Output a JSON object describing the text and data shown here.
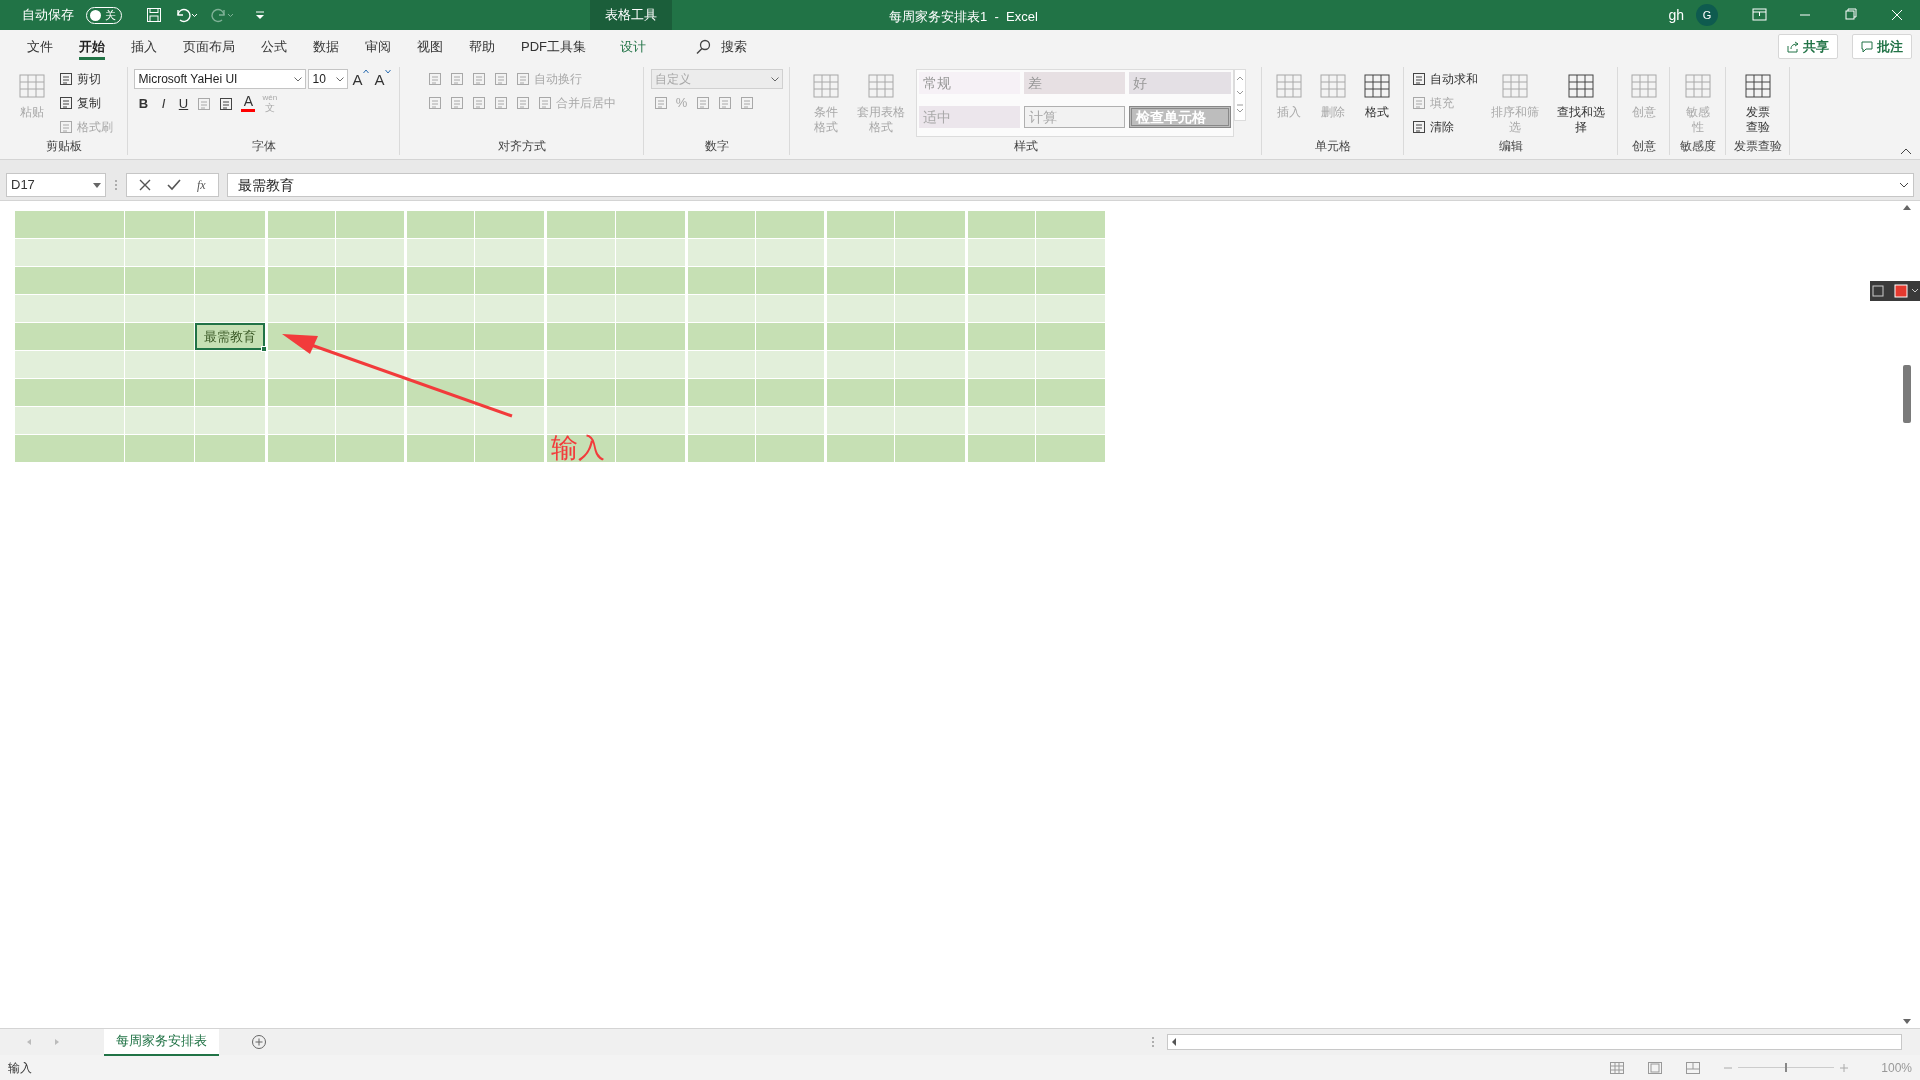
{
  "title_bar": {
    "autosave_label": "自动保存",
    "autosave_on": false,
    "autosave_state": "关",
    "context_tab": "表格工具",
    "title": "每周家务安排表1  -  Excel",
    "user": "gh",
    "avatar": "G"
  },
  "menu_tabs": [
    {
      "label": "文件",
      "selected": false,
      "kind": "normal"
    },
    {
      "label": "开始",
      "selected": true,
      "kind": "normal"
    },
    {
      "label": "插入",
      "selected": false,
      "kind": "normal"
    },
    {
      "label": "页面布局",
      "selected": false,
      "kind": "normal"
    },
    {
      "label": "公式",
      "selected": false,
      "kind": "normal"
    },
    {
      "label": "数据",
      "selected": false,
      "kind": "normal"
    },
    {
      "label": "审阅",
      "selected": false,
      "kind": "normal"
    },
    {
      "label": "视图",
      "selected": false,
      "kind": "normal"
    },
    {
      "label": "帮助",
      "selected": false,
      "kind": "normal"
    },
    {
      "label": "PDF工具集",
      "selected": false,
      "kind": "normal"
    },
    {
      "label": "设计",
      "selected": false,
      "kind": "contextual"
    }
  ],
  "search": {
    "label": "搜索"
  },
  "share_button": "共享",
  "comment_button": "批注",
  "ribbon": {
    "groups": [
      {
        "label": "剪贴板",
        "items": [
          {
            "kind": "large",
            "label": "粘贴",
            "disabled": true
          },
          {
            "kind": "stack",
            "rows": [
              {
                "items": [
                  {
                    "kind": "small",
                    "label": "剪切",
                    "disabled": false
                  }
                ]
              },
              {
                "items": [
                  {
                    "kind": "small",
                    "label": "复制",
                    "disabled": false
                  }
                ]
              },
              {
                "items": [
                  {
                    "kind": "small",
                    "label": "格式刷",
                    "disabled": true
                  }
                ]
              }
            ]
          }
        ]
      },
      {
        "label": "字体",
        "items": [
          {
            "kind": "stack",
            "rows": [
              {
                "items": [
                  {
                    "kind": "combo",
                    "label": "Microsoft YaHei UI",
                    "disabled": false
                  },
                  {
                    "kind": "combo",
                    "label": "10",
                    "disabled": false
                  },
                  {
                    "kind": "grow",
                    "label": "A",
                    "disabled": false
                  },
                  {
                    "kind": "shrink",
                    "label": "A",
                    "disabled": false
                  }
                ]
              },
              {
                "items": [
                  {
                    "kind": "glyph",
                    "label": "B",
                    "disabled": false
                  },
                  {
                    "kind": "glyph",
                    "label": "I",
                    "disabled": false
                  },
                  {
                    "kind": "glyph",
                    "label": "U",
                    "disabled": false
                  },
                  {
                    "kind": "icon",
                    "disabled": true
                  },
                  {
                    "kind": "icon",
                    "disabled": false
                  },
                  {
                    "kind": "color",
                    "label": "A",
                    "disabled": false
                  },
                  {
                    "kind": "phonetic",
                    "label": "wén",
                    "sub": "文",
                    "disabled": true
                  }
                ]
              }
            ]
          }
        ]
      },
      {
        "label": "对齐方式",
        "items": [
          {
            "kind": "stack",
            "rows": [
              {
                "items": [
                  {
                    "kind": "icon",
                    "disabled": true
                  },
                  {
                    "kind": "icon",
                    "disabled": true
                  },
                  {
                    "kind": "icon",
                    "disabled": true
                  },
                  {
                    "kind": "icon",
                    "disabled": true
                  },
                  {
                    "kind": "small",
                    "label": "自动换行",
                    "disabled": true
                  }
                ]
              },
              {
                "items": [
                  {
                    "kind": "icon",
                    "disabled": true
                  },
                  {
                    "kind": "icon",
                    "disabled": true
                  },
                  {
                    "kind": "icon",
                    "disabled": true
                  },
                  {
                    "kind": "icon",
                    "disabled": true
                  },
                  {
                    "kind": "icon",
                    "disabled": true
                  },
                  {
                    "kind": "small",
                    "label": "合并后居中",
                    "disabled": true
                  }
                ]
              }
            ]
          }
        ]
      },
      {
        "label": "数字",
        "items": [
          {
            "kind": "stack",
            "rows": [
              {
                "items": [
                  {
                    "kind": "combo",
                    "label": "自定义",
                    "disabled": true
                  }
                ]
              },
              {
                "items": [
                  {
                    "kind": "icon",
                    "disabled": true
                  },
                  {
                    "kind": "glyph",
                    "label": "%",
                    "disabled": true
                  },
                  {
                    "kind": "icon",
                    "disabled": true
                  },
                  {
                    "kind": "icon",
                    "disabled": true
                  },
                  {
                    "kind": "icon",
                    "disabled": true
                  }
                ]
              }
            ]
          }
        ]
      },
      {
        "label": "样式",
        "items": [
          {
            "kind": "large",
            "label": "条件格式",
            "disabled": true
          },
          {
            "kind": "large",
            "label": "套用表格格式",
            "disabled": true
          },
          {
            "kind": "styles",
            "cells": [
              {
                "label": "常规",
                "kind": "normal"
              },
              {
                "label": "差",
                "kind": "bad"
              },
              {
                "label": "好",
                "kind": "good"
              },
              {
                "label": "适中",
                "kind": "neutral"
              },
              {
                "label": "计算",
                "kind": "calculation"
              },
              {
                "label": "检查单元格",
                "kind": "check"
              }
            ]
          }
        ]
      },
      {
        "label": "单元格",
        "items": [
          {
            "kind": "large",
            "label": "插入",
            "disabled": true
          },
          {
            "kind": "large",
            "label": "删除",
            "disabled": true
          },
          {
            "kind": "large",
            "label": "格式",
            "disabled": false
          }
        ]
      },
      {
        "label": "编辑",
        "items": [
          {
            "kind": "stack",
            "rows": [
              {
                "items": [
                  {
                    "kind": "small",
                    "label": "自动求和",
                    "disabled": false
                  }
                ]
              },
              {
                "items": [
                  {
                    "kind": "small",
                    "label": "填充",
                    "disabled": true
                  }
                ]
              },
              {
                "items": [
                  {
                    "kind": "small",
                    "label": "清除",
                    "disabled": false
                  }
                ]
              }
            ]
          },
          {
            "kind": "large",
            "label": "排序和筛选",
            "disabled": true
          },
          {
            "kind": "large",
            "label": "查找和选择",
            "disabled": false
          }
        ]
      },
      {
        "label": "创意",
        "items": [
          {
            "kind": "large",
            "label": "创意",
            "disabled": true
          }
        ]
      },
      {
        "label": "敏感度",
        "items": [
          {
            "kind": "large",
            "label": "敏感性",
            "disabled": true
          }
        ]
      },
      {
        "label": "发票查验",
        "items": [
          {
            "kind": "large",
            "label": "发票查验",
            "disabled": false
          }
        ]
      }
    ]
  },
  "formula_bar": {
    "name_box": "D17",
    "function_button": "fx",
    "formula": "最需教育"
  },
  "sheet": {
    "active_cell": "最需教育"
  },
  "annotation": {
    "text": "输入"
  },
  "sheet_tabs": [
    {
      "label": "每周家务安排表",
      "selected": true
    }
  ],
  "status_bar": {
    "mode": "输入",
    "zoom": "100%",
    "zoom_slider": {
      "level": 0.5
    }
  }
}
